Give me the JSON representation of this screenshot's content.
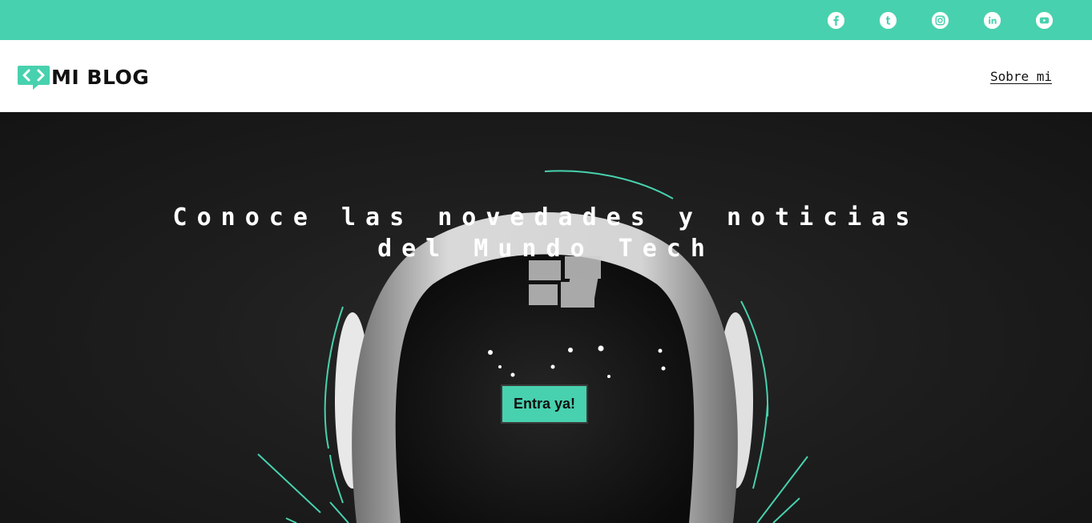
{
  "topbar": {
    "color": "#48d1ae",
    "social": [
      {
        "icon": "facebook-icon"
      },
      {
        "icon": "tumblr-icon"
      },
      {
        "icon": "instagram-icon"
      },
      {
        "icon": "linkedin-icon"
      },
      {
        "icon": "youtube-icon"
      }
    ]
  },
  "header": {
    "logo_text": "MI BLOG",
    "logo_icon": "code-chat-icon",
    "nav": {
      "about_label": "Sobre mi"
    }
  },
  "hero": {
    "title": "Conoce las novedades y noticias del Mundo Tech",
    "cta_label": "Entra ya!",
    "background": "astronaut-helmet-photo"
  },
  "colors": {
    "accent": "#48d1ae",
    "header_bg": "#ffffff",
    "text_dark": "#111111"
  }
}
